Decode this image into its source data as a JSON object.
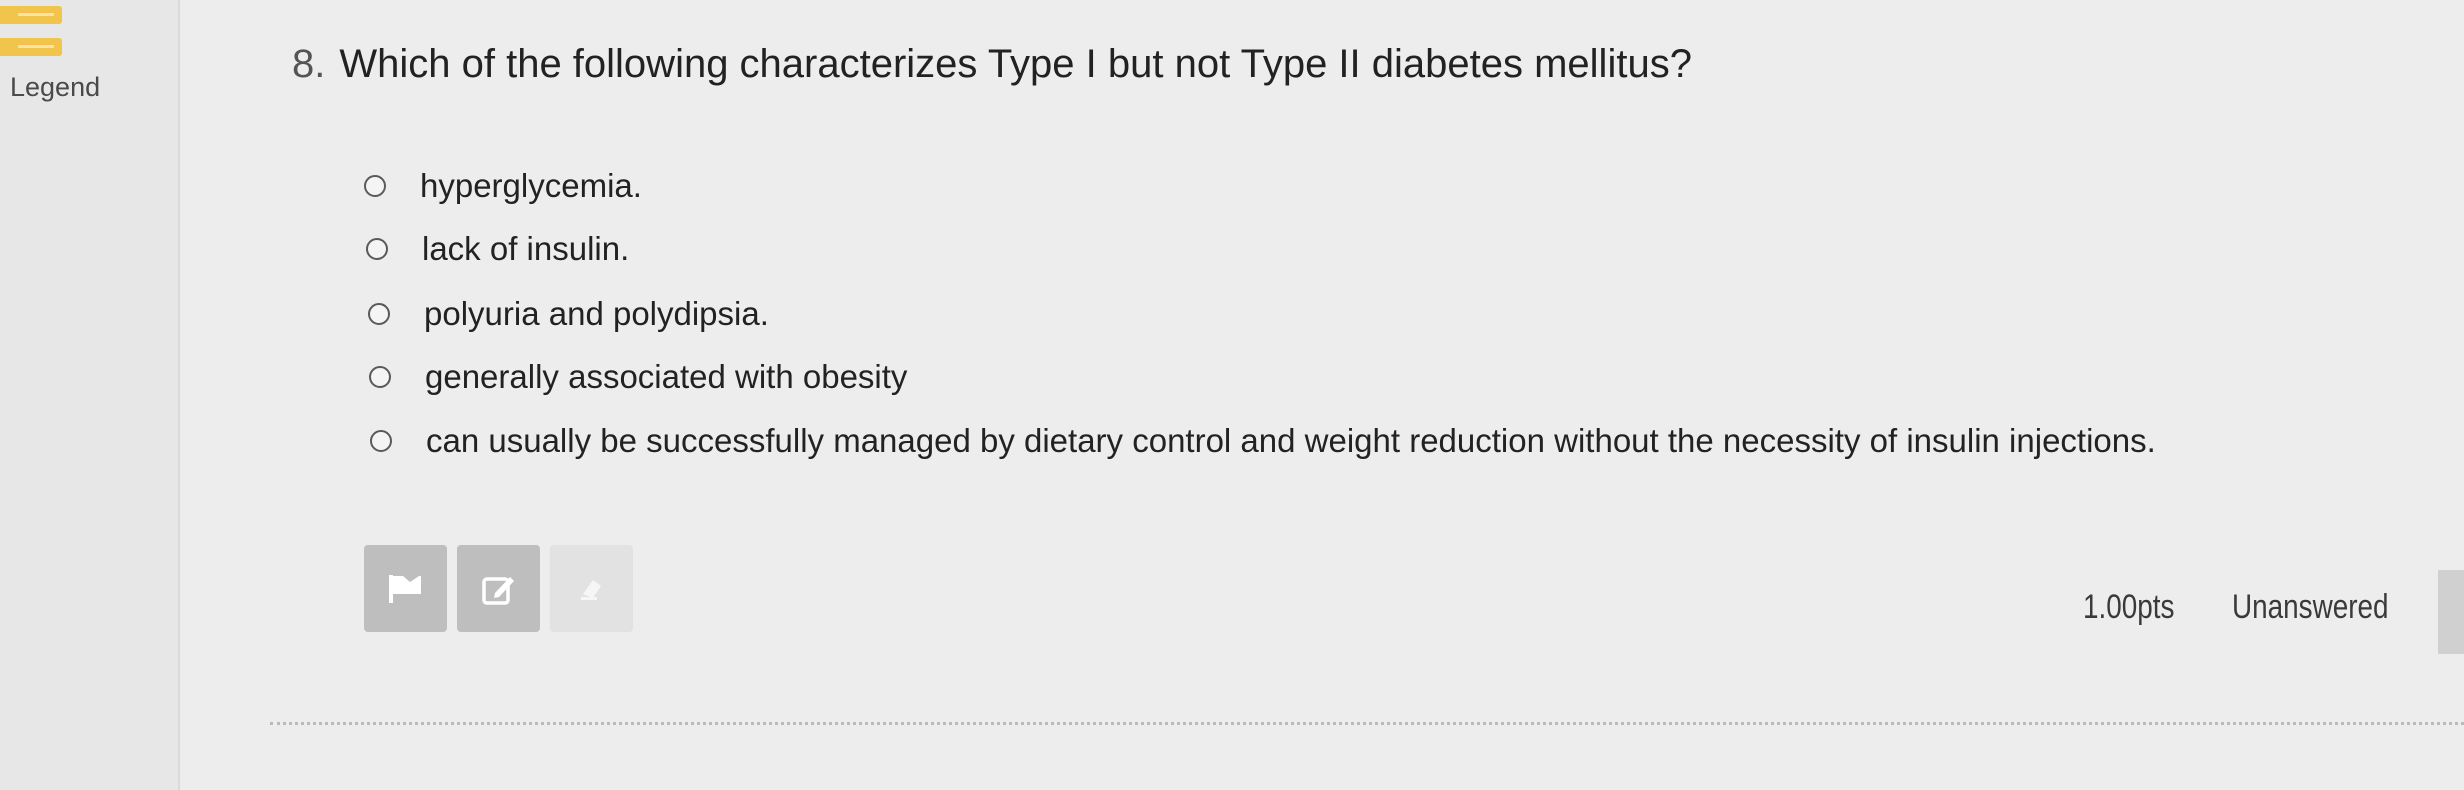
{
  "sidebar": {
    "legend_label": "Legend",
    "swatch_colors": [
      "#f0c34a",
      "#f0c34a"
    ]
  },
  "question": {
    "number": "8.",
    "text": "Which of the following characterizes Type I but not Type II diabetes mellitus?",
    "options": [
      "hyperglycemia.",
      "lack of insulin.",
      "polyuria and polydipsia.",
      "generally associated with obesity",
      "can usually be successfully managed by dietary control and weight reduction without the necessity of insulin injections."
    ],
    "selected_option": null
  },
  "toolbar": {
    "buttons": [
      {
        "icon": "flag-icon"
      },
      {
        "icon": "edit-note-icon"
      },
      {
        "icon": "eliminate-icon",
        "disabled": true
      }
    ]
  },
  "footer": {
    "points": "1.00pts",
    "status": "Unanswered"
  }
}
